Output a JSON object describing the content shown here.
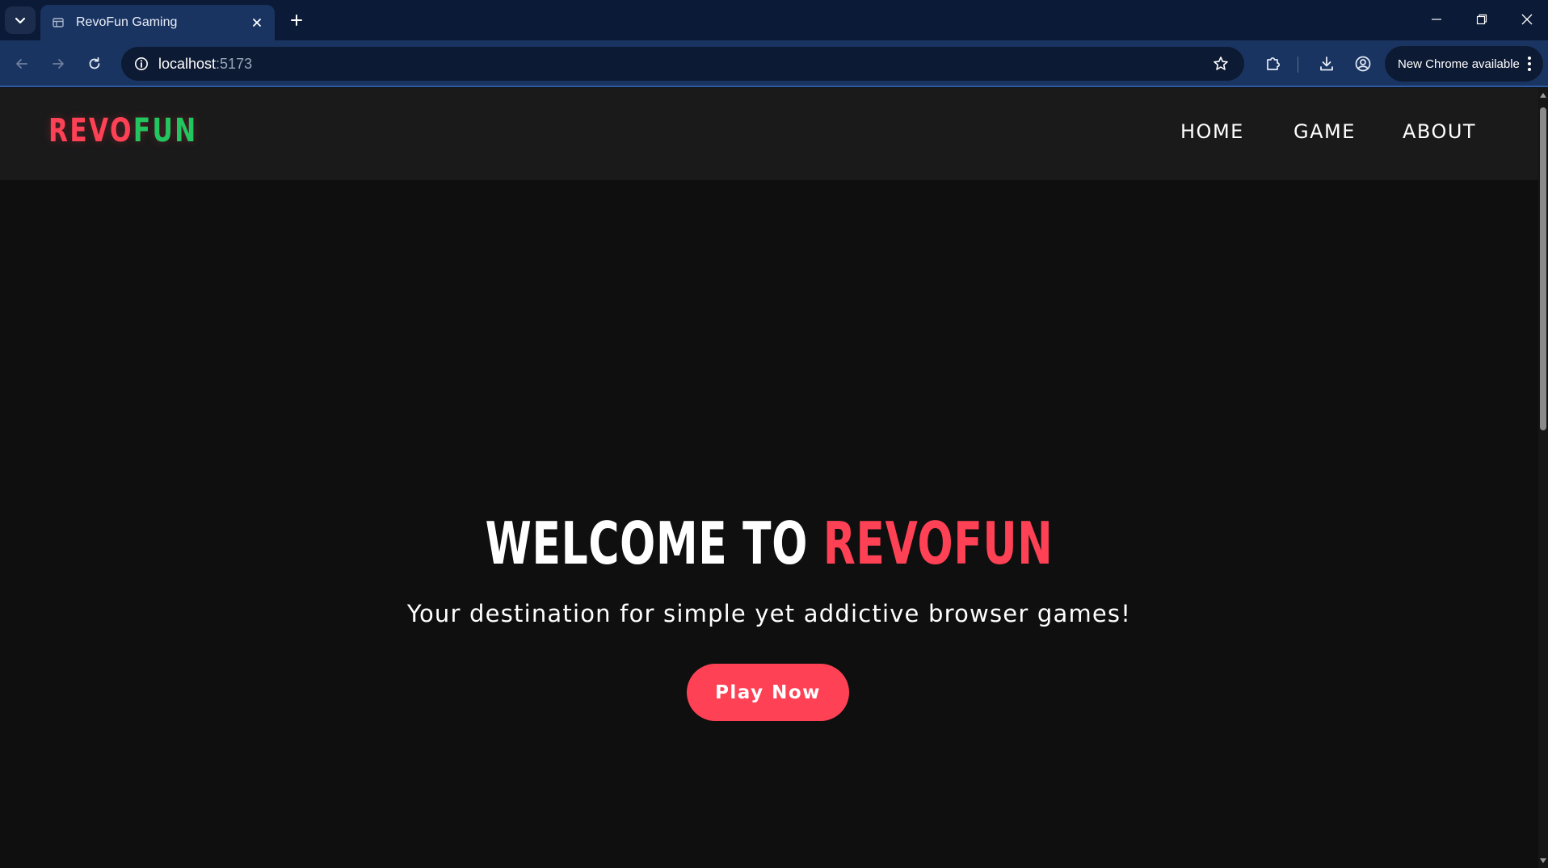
{
  "browser": {
    "tab": {
      "title": "RevoFun Gaming",
      "favicon": "page-icon"
    },
    "address": {
      "host": "localhost",
      "port": ":5173"
    },
    "update_chip_label": "New Chrome available",
    "icons": {
      "tab_search": "chevron-down-icon",
      "tab_close": "close-icon",
      "new_tab": "plus-icon",
      "back": "arrow-left-icon",
      "forward": "arrow-right-icon",
      "reload": "reload-icon",
      "site_info": "info-icon",
      "bookmark": "star-icon",
      "extensions": "puzzle-icon",
      "downloads": "download-icon",
      "profile": "profile-icon",
      "menu": "three-dots-icon",
      "minimize": "minimize-icon",
      "restore": "restore-icon",
      "close_window": "close-icon"
    },
    "colors": {
      "tabstrip": "#0b1a36",
      "toolbar": "#1a3461",
      "omnibox": "#0d1a33"
    }
  },
  "site": {
    "logo": {
      "part1": "REVO",
      "part2": "FUN"
    },
    "nav": [
      {
        "label": "HOME"
      },
      {
        "label": "GAME"
      },
      {
        "label": "ABOUT"
      }
    ],
    "hero": {
      "title_prefix": "WELCOME TO",
      "title_accent": "REVOFUN",
      "subtitle": "Your destination for simple yet addictive browser games!",
      "cta_label": "Play Now"
    },
    "colors": {
      "accent_red": "#ff4155",
      "accent_green": "#22c55e",
      "header_bg": "#1a1a1a",
      "page_bg": "#0f0f0f"
    }
  }
}
